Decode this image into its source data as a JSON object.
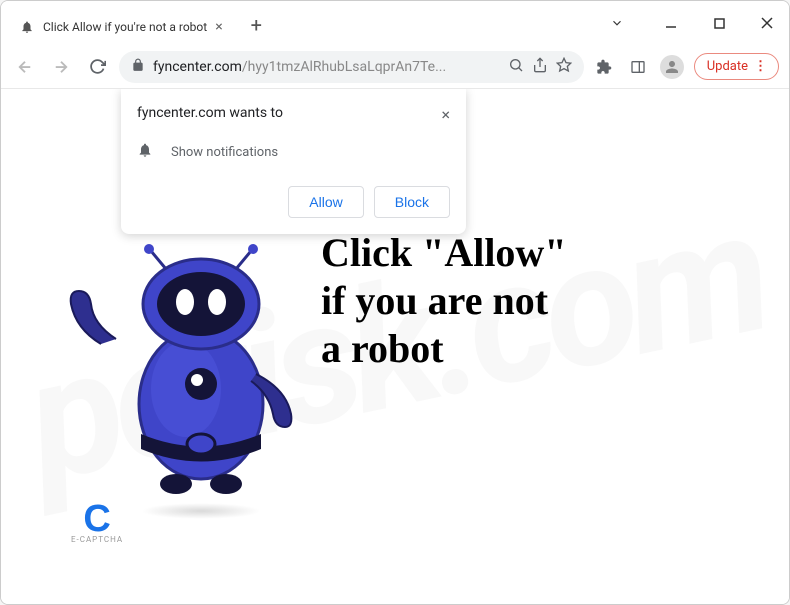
{
  "window": {
    "tab_title": "Click Allow if you're not a robot",
    "new_tab_tooltip": "+"
  },
  "toolbar": {
    "url_domain": "fyncenter.com",
    "url_path": "/hyy1tmzAlRhubLsaLqprAn7Te...",
    "update_label": "Update"
  },
  "permission": {
    "title": "fyncenter.com wants to",
    "item": "Show notifications",
    "allow": "Allow",
    "block": "Block"
  },
  "page": {
    "headline_line1": "Click \"Allow\"",
    "headline_line2": "if you are not",
    "headline_line3": "a robot",
    "captcha_label": "E-CAPTCHA"
  },
  "watermark": "pcrisk.com"
}
